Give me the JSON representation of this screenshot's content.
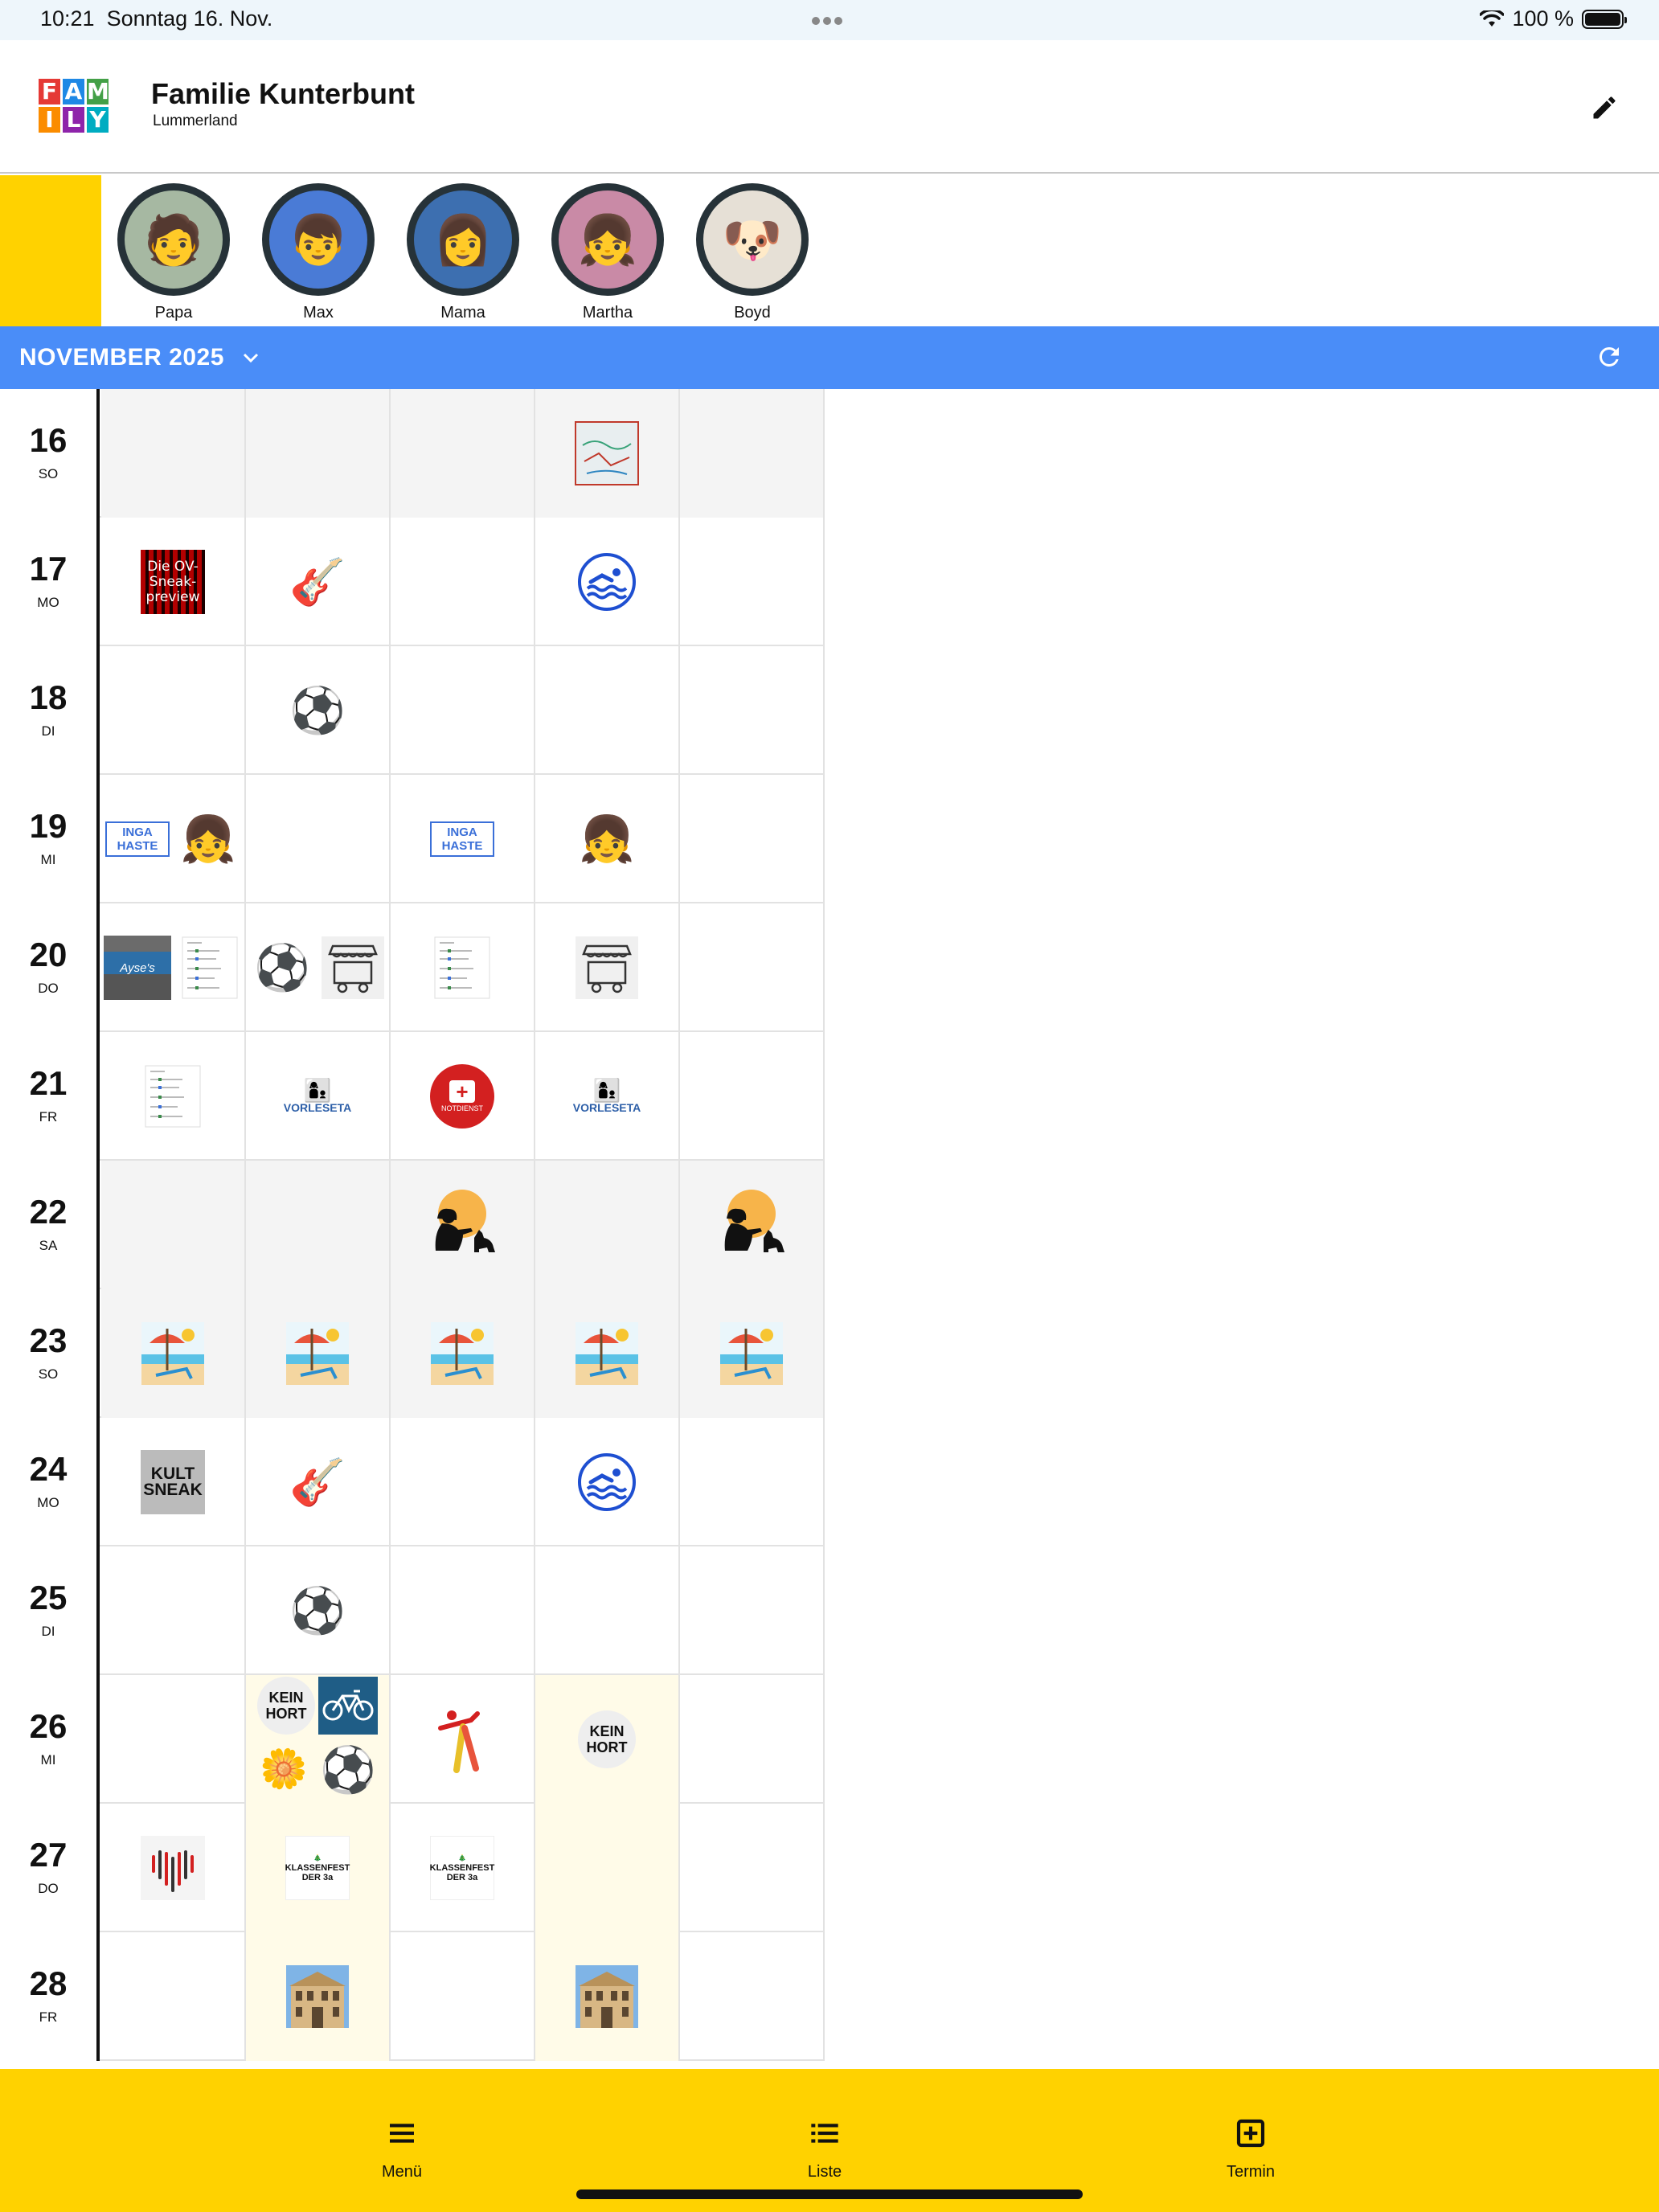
{
  "status": {
    "time": "10:21",
    "date": "Sonntag 16. Nov.",
    "battery": "100 %",
    "battery_level": 1.0
  },
  "header": {
    "logo_top": "FAM",
    "logo_bottom": "ILY",
    "title": "Familie Kunterbunt",
    "subtitle": "Lummerland"
  },
  "members": [
    {
      "name": "Papa",
      "icon": "man-portrait",
      "glyph": "🧑"
    },
    {
      "name": "Max",
      "icon": "boy-portrait",
      "glyph": "👦"
    },
    {
      "name": "Mama",
      "icon": "woman-portrait",
      "glyph": "👩"
    },
    {
      "name": "Martha",
      "icon": "girl-portrait",
      "glyph": "👧"
    },
    {
      "name": "Boyd",
      "icon": "dog-portrait",
      "glyph": "🐶"
    }
  ],
  "month": {
    "label": "NOVEMBER 2025"
  },
  "event_texts": {
    "sneak": "Die OV-Sneak-preview",
    "kult": "KULT SNEAK",
    "inga": "INGA HASTE",
    "vorlese": "VORLESETA",
    "notdienst": "NOTDIENST",
    "kein_hort": "KEIN HORT",
    "klassenfest": "KLASSENFEST DER 3a",
    "ayses": "Ayse's"
  },
  "days": [
    {
      "num": "16",
      "name": "SO",
      "weekend": true,
      "cells": [
        [],
        [],
        [],
        [
          "map-image"
        ],
        []
      ]
    },
    {
      "num": "17",
      "name": "MO",
      "cells": [
        [
          "sneak-preview-poster"
        ],
        [
          "guitar-icon"
        ],
        [],
        [
          "swimming-icon"
        ],
        []
      ]
    },
    {
      "num": "18",
      "name": "DI",
      "cells": [
        [],
        [
          "soccer-ball-icon"
        ],
        [],
        [],
        []
      ]
    },
    {
      "num": "19",
      "name": "MI",
      "cells": [
        [
          "inga-haste-logo",
          "singing-girl-icon"
        ],
        [],
        [
          "inga-haste-logo"
        ],
        [
          "singing-girl-icon"
        ],
        []
      ]
    },
    {
      "num": "20",
      "name": "DO",
      "cells": [
        [
          "ayses-photo",
          "schedule-doc"
        ],
        [
          "soccer-ball-icon",
          "market-cart-icon"
        ],
        [
          "schedule-doc"
        ],
        [
          "market-cart-icon"
        ],
        []
      ]
    },
    {
      "num": "21",
      "name": "FR",
      "cells": [
        [
          "schedule-doc"
        ],
        [
          "vorlesetag-logo"
        ],
        [
          "notdienst-icon"
        ],
        [
          "vorlesetag-logo"
        ],
        []
      ]
    },
    {
      "num": "22",
      "name": "SA",
      "weekend": true,
      "cells": [
        [],
        [],
        [
          "dog-training-icon"
        ],
        [],
        [
          "dog-training-icon"
        ]
      ]
    },
    {
      "num": "23",
      "name": "SO",
      "weekend": true,
      "cells": [
        [
          "beach-holiday-icon"
        ],
        [
          "beach-holiday-icon"
        ],
        [
          "beach-holiday-icon"
        ],
        [
          "beach-holiday-icon"
        ],
        [
          "beach-holiday-icon"
        ]
      ]
    },
    {
      "num": "24",
      "name": "MO",
      "cells": [
        [
          "kult-sneak-poster"
        ],
        [
          "guitar-icon"
        ],
        [],
        [
          "swimming-icon"
        ],
        []
      ]
    },
    {
      "num": "25",
      "name": "DI",
      "cells": [
        [],
        [
          "soccer-ball-icon"
        ],
        [],
        [],
        []
      ]
    },
    {
      "num": "26",
      "name": "MI",
      "hort": [
        1,
        3
      ],
      "cells": [
        [],
        [
          "kein-hort-badge",
          "bicycle-icon",
          "flower-icon",
          "soccer-ball-icon"
        ],
        [
          "gymnastics-icon"
        ],
        [
          "kein-hort-badge"
        ],
        []
      ]
    },
    {
      "num": "27",
      "name": "DO",
      "hort": [
        1,
        3
      ],
      "cells": [
        [
          "heart-chart-icon"
        ],
        [
          "klassenfest-flyer"
        ],
        [
          "klassenfest-flyer"
        ],
        [],
        []
      ]
    },
    {
      "num": "28",
      "name": "FR",
      "hort": [
        1,
        3
      ],
      "cells": [
        [],
        [
          "building-photo"
        ],
        [],
        [
          "building-photo"
        ],
        []
      ]
    }
  ],
  "nav": {
    "menu": "Menü",
    "list": "Liste",
    "add": "Termin"
  },
  "colors": {
    "accent_blue": "#4a8df8",
    "yellow": "#ffd200",
    "avatar_ring": "#263238"
  }
}
